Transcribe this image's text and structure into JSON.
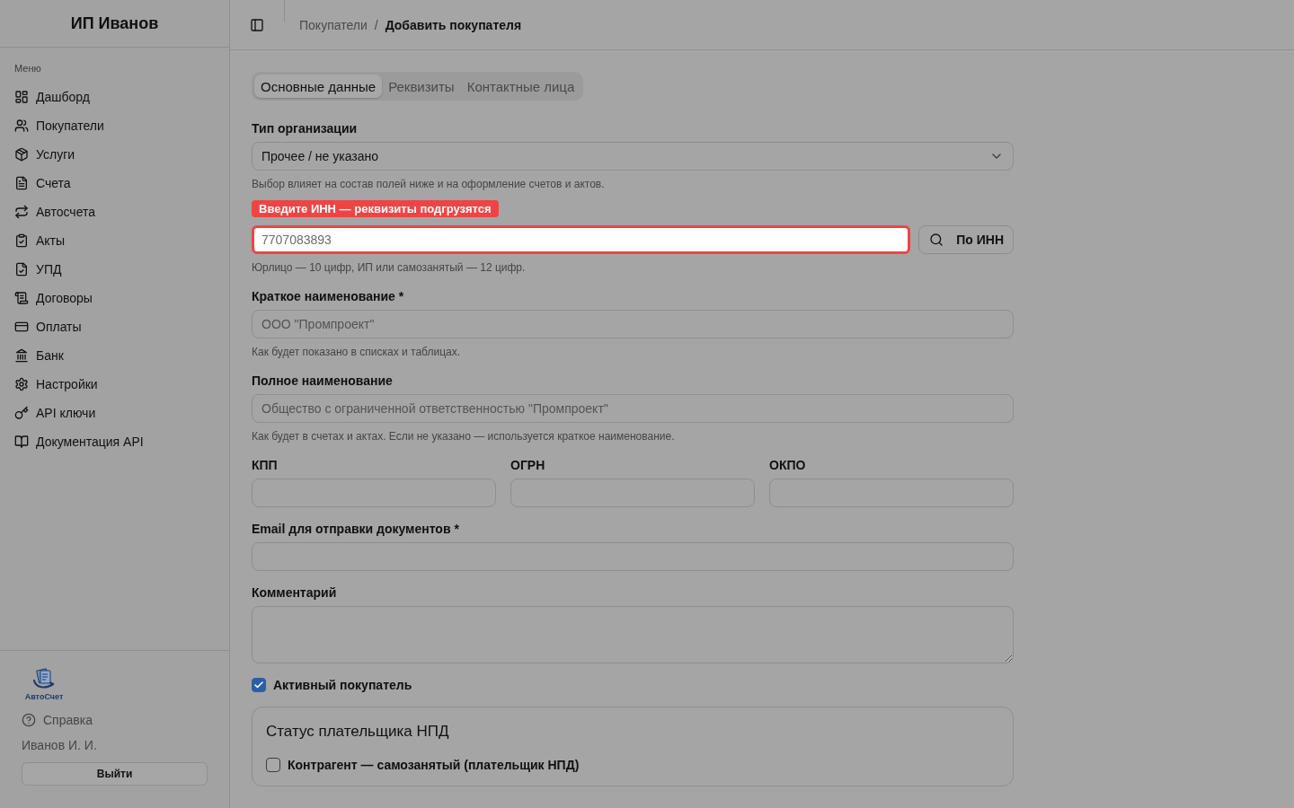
{
  "sidebar": {
    "title": "ИП Иванов",
    "section_label": "Меню",
    "items": [
      {
        "label": "Дашборд",
        "selected": false
      },
      {
        "label": "Покупатели",
        "selected": false
      },
      {
        "label": "Услуги",
        "selected": false
      },
      {
        "label": "Счета",
        "selected": false
      },
      {
        "label": "Автосчета",
        "selected": false
      },
      {
        "label": "Акты",
        "selected": false
      },
      {
        "label": "УПД",
        "selected": false
      },
      {
        "label": "Договоры",
        "selected": false
      },
      {
        "label": "Оплаты",
        "selected": false
      },
      {
        "label": "Банк",
        "selected": false
      },
      {
        "label": "Настройки",
        "selected": false
      },
      {
        "label": "API ключи",
        "selected": false
      },
      {
        "label": "Документация API",
        "selected": false
      }
    ],
    "footer": {
      "logo_text": "АвтоСчет",
      "help": "Справка",
      "user": "Иванов И. И.",
      "logout": "Выйти"
    }
  },
  "topbar": {
    "breadcrumbs": [
      {
        "label": "Покупатели",
        "current": false
      },
      {
        "label": "Добавить покупателя",
        "current": true
      }
    ],
    "separator": "/"
  },
  "tabs": [
    {
      "label": "Основные данные",
      "selected": true
    },
    {
      "label": "Реквизиты",
      "selected": false
    },
    {
      "label": "Контактные лица",
      "selected": false
    }
  ],
  "form": {
    "fields": [
      {
        "kind": "select",
        "label": "Тип организации",
        "value": "Прочее / не указано",
        "hint": "Выбор влияет на состав полей ниже и на оформление счетов и актов."
      },
      {
        "kind": "inn",
        "tour_hint": "Введите ИНН — реквизиты подгрузятся",
        "placeholder": "7707083893",
        "highlighted": true,
        "button": "По ИНН",
        "hint": "Юрлицо — 10 цифр, ИП или самозанятый — 12 цифр."
      },
      {
        "kind": "text",
        "label": "Краткое наименование *",
        "placeholder": "ООО \"Промпроект\"",
        "hint": "Как будет показано в списках и таблицах."
      },
      {
        "kind": "text",
        "label": "Полное наименование",
        "placeholder": "Общество с ограниченной ответственностью \"Промпроект\"",
        "hint": "Как будет в счетах и актах. Если не указано — используется краткое наименование."
      },
      {
        "kind": "columns",
        "columns": [
          {
            "label": "КПП"
          },
          {
            "label": "ОГРН"
          },
          {
            "label": "ОКПО"
          }
        ]
      },
      {
        "kind": "text",
        "label": "Email для отправки документов *"
      },
      {
        "kind": "textarea",
        "label": "Комментарий"
      },
      {
        "kind": "checkbox",
        "label": "Активный покупатель",
        "checked": true
      },
      {
        "kind": "card",
        "title": "Статус плательщика НПД",
        "checkbox": {
          "label": "Контрагент — самозанятый (плательщик НПД)",
          "checked": false
        }
      }
    ]
  }
}
